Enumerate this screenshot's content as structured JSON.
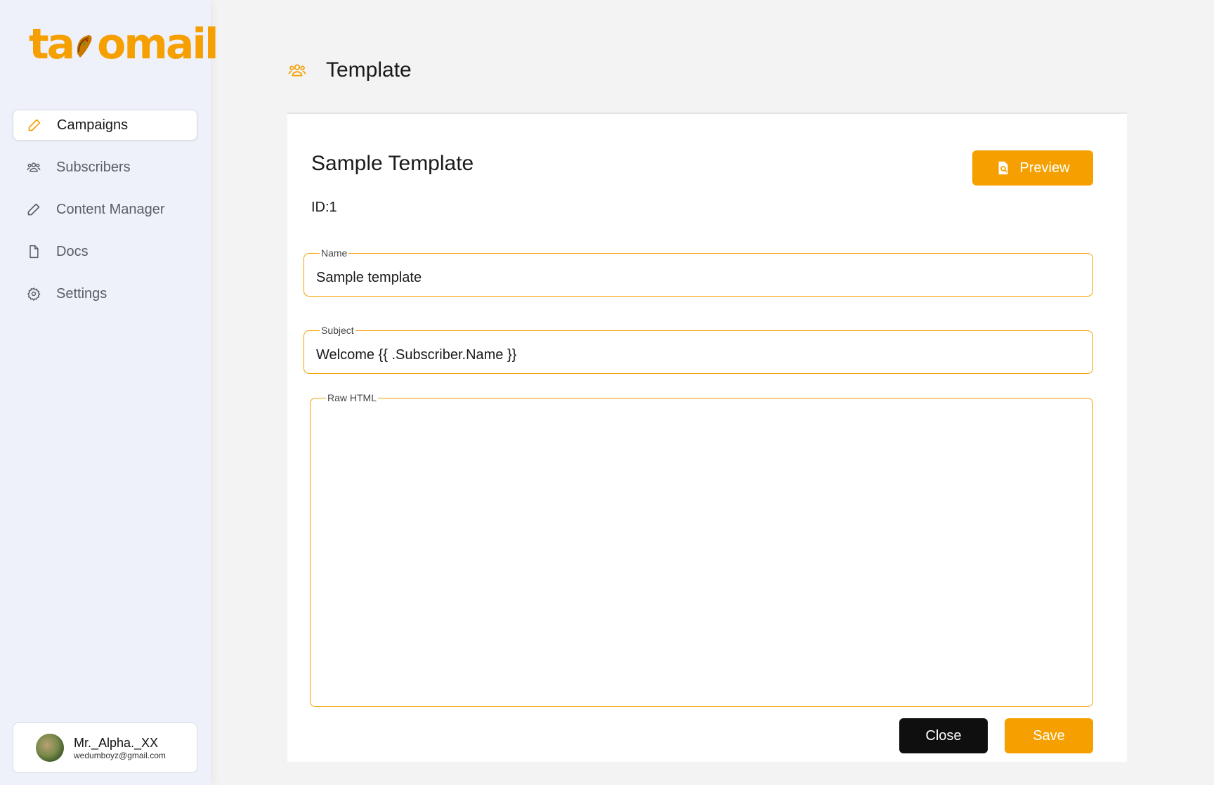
{
  "brand": {
    "logo_text_left": "ta",
    "logo_text_right": "omail",
    "accent": "#f5a000"
  },
  "sidebar": {
    "items": [
      {
        "label": "Campaigns",
        "icon": "pencil-icon",
        "active": true
      },
      {
        "label": "Subscribers",
        "icon": "users-icon",
        "active": false
      },
      {
        "label": "Content Manager",
        "icon": "pencil-icon",
        "active": false
      },
      {
        "label": "Docs",
        "icon": "document-icon",
        "active": false
      },
      {
        "label": "Settings",
        "icon": "gear-icon",
        "active": false
      }
    ]
  },
  "user": {
    "name": "Mr._Alpha._XX",
    "email": "wedumboyz@gmail.com"
  },
  "header": {
    "title": "Template",
    "icon": "users-icon"
  },
  "template": {
    "title": "Sample Template",
    "id_text": "ID:1",
    "preview_label": "Preview",
    "name_legend": "Name",
    "name_value": "Sample template",
    "subject_legend": "Subject",
    "subject_value": "Welcome {{ .Subscriber.Name }}",
    "raw_legend": "Raw HTML",
    "raw_value": ""
  },
  "actions": {
    "close_label": "Close",
    "save_label": "Save"
  }
}
